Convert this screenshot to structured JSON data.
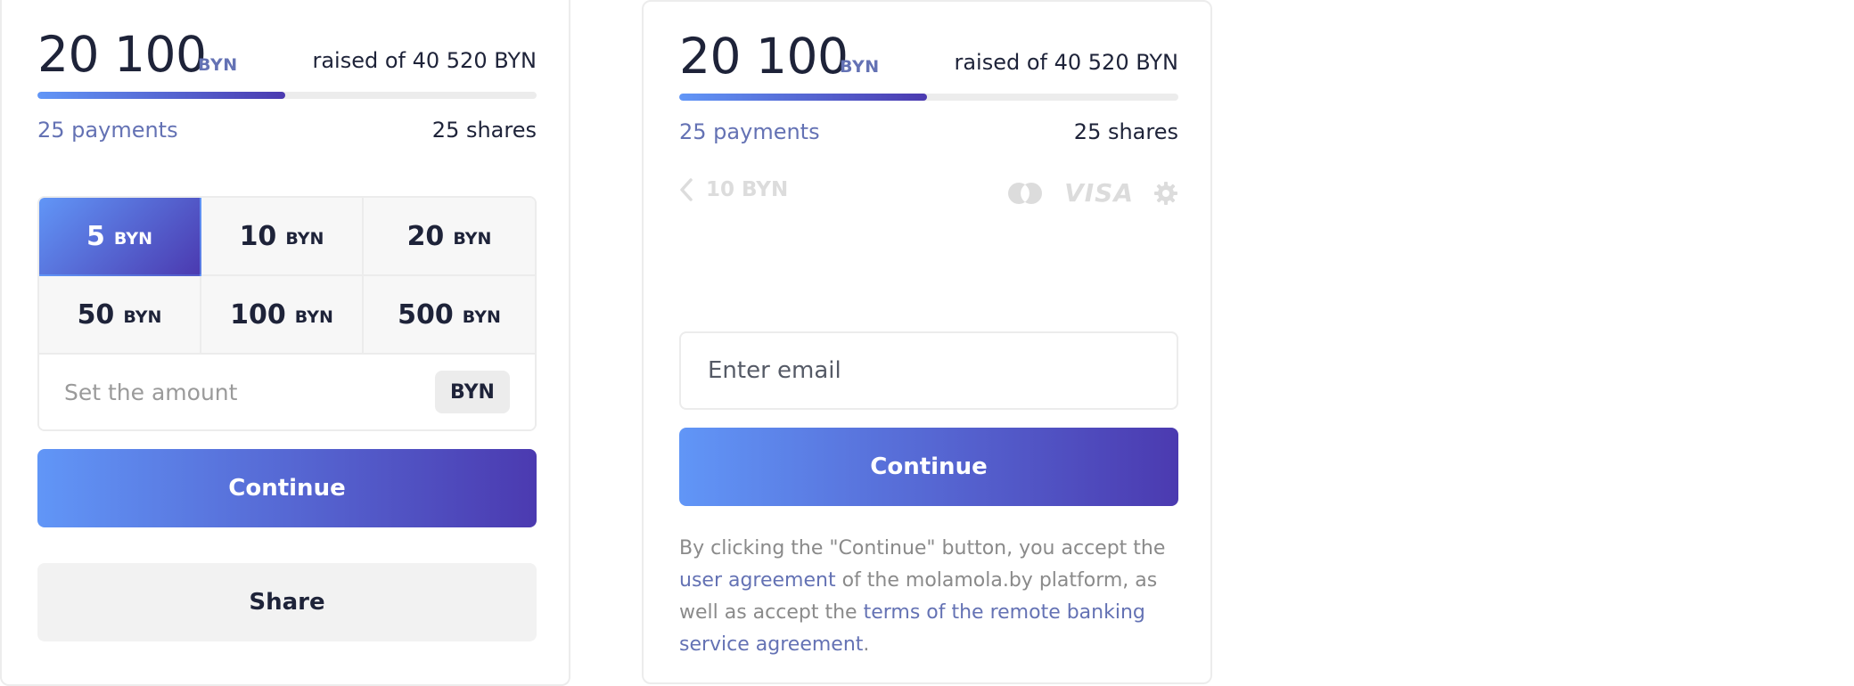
{
  "campaign": {
    "raised_amount": "20 100",
    "currency": "BYN",
    "raised_of_label": "raised of 40 520 BYN",
    "progress_fraction": 0.496,
    "payments_label": "25 payments",
    "shares_label": "25 shares"
  },
  "amount_picker": {
    "options": [
      {
        "value": "5",
        "currency": "BYN",
        "selected": true
      },
      {
        "value": "10",
        "currency": "BYN",
        "selected": false
      },
      {
        "value": "20",
        "currency": "BYN",
        "selected": false
      },
      {
        "value": "50",
        "currency": "BYN",
        "selected": false
      },
      {
        "value": "100",
        "currency": "BYN",
        "selected": false
      },
      {
        "value": "500",
        "currency": "BYN",
        "selected": false
      }
    ],
    "custom_placeholder": "Set the amount",
    "custom_currency": "BYN"
  },
  "left_actions": {
    "continue_label": "Continue",
    "share_label": "Share"
  },
  "payment_step": {
    "back_label": "10 BYN",
    "icons": [
      "mastercard-icon",
      "visa-logo",
      "gear-icon"
    ],
    "visa_text": "VISA",
    "email_placeholder": "Enter email",
    "continue_label": "Continue",
    "terms": {
      "part1": "By clicking the \"Continue\" button, you accept the ",
      "link1": "user agreement",
      "part2": " of the molamola.by platform, as well as accept the ",
      "link2": "terms of the remote banking service agreement",
      "part3": "."
    }
  },
  "colors": {
    "accent_start": "#6196f7",
    "accent_end": "#4b3ab0",
    "link": "#6472b4",
    "text": "#1e2339",
    "muted": "#9a9a9a"
  }
}
